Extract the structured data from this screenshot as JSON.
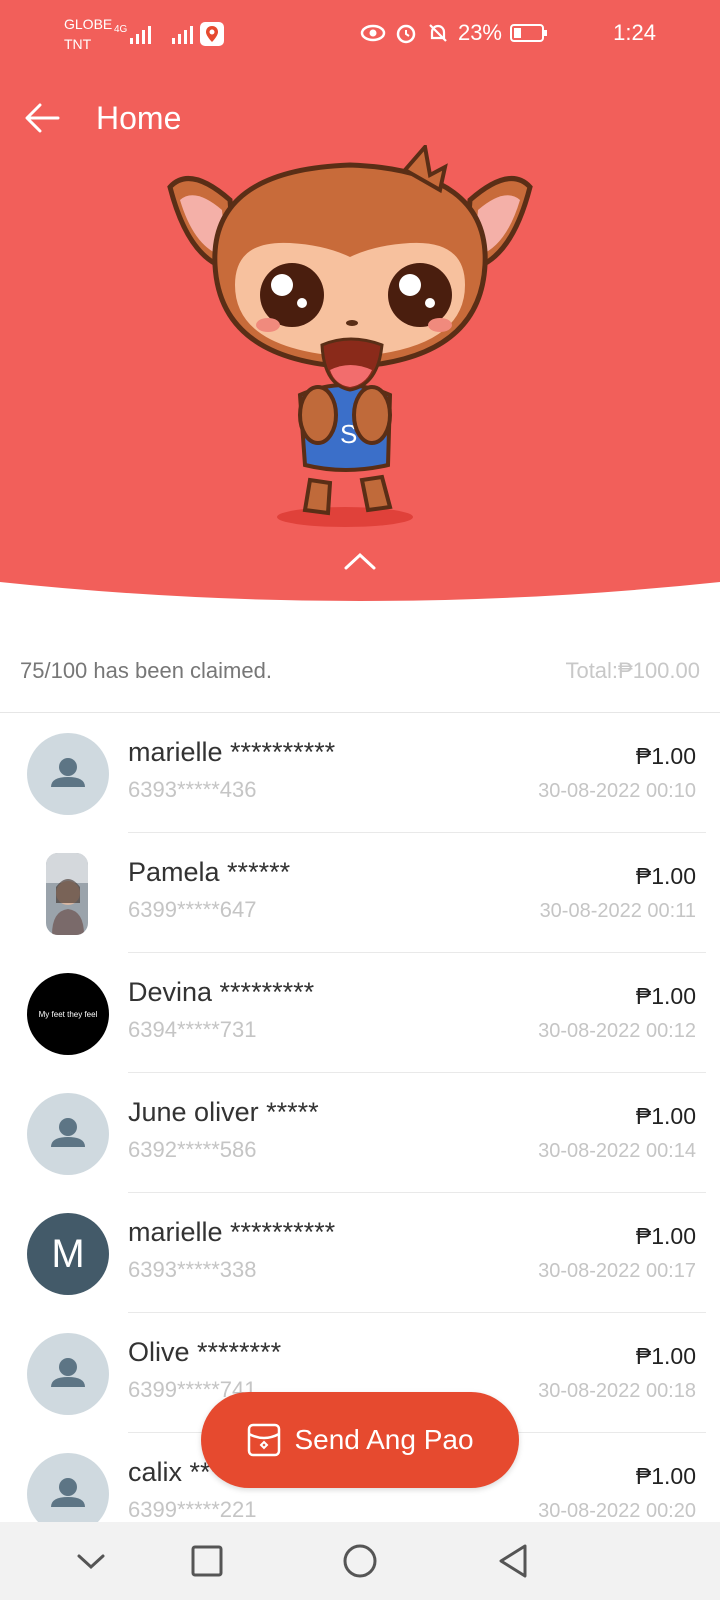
{
  "status": {
    "carrier_line1": "GLOBE",
    "carrier_line2": "TNT",
    "network_type": "4G",
    "battery": "23%",
    "time": "1:24"
  },
  "header": {
    "title": "Home",
    "bg_color": "#f25f5a"
  },
  "summary": {
    "claimed_text": "75/100 has been claimed.",
    "total_text": "Total:₱100.00"
  },
  "claims": [
    {
      "name": "marielle **********",
      "phone": "6393*****436",
      "amount": "₱1.00",
      "date": "30-08-2022 00:10",
      "avatar": "default"
    },
    {
      "name": "Pamela ******",
      "phone": "6399*****647",
      "amount": "₱1.00",
      "date": "30-08-2022 00:11",
      "avatar": "photo"
    },
    {
      "name": "Devina *********",
      "phone": "6394*****731",
      "amount": "₱1.00",
      "date": "30-08-2022 00:12",
      "avatar": "black",
      "avatar_text": "My feet they feel"
    },
    {
      "name": "June oliver *****",
      "phone": "6392*****586",
      "amount": "₱1.00",
      "date": "30-08-2022 00:14",
      "avatar": "default"
    },
    {
      "name": "marielle **********",
      "phone": "6393*****338",
      "amount": "₱1.00",
      "date": "30-08-2022 00:17",
      "avatar": "letter",
      "avatar_letter": "M"
    },
    {
      "name": "Olive ********",
      "phone": "6399*****741",
      "amount": "₱1.00",
      "date": "30-08-2022 00:18",
      "avatar": "default"
    },
    {
      "name": "calix ***",
      "phone": "6399*****221",
      "amount": "₱1.00",
      "date": "30-08-2022 00:20",
      "avatar": "default"
    }
  ],
  "fab": {
    "label": "Send Ang Pao",
    "color": "#e64a2f"
  }
}
